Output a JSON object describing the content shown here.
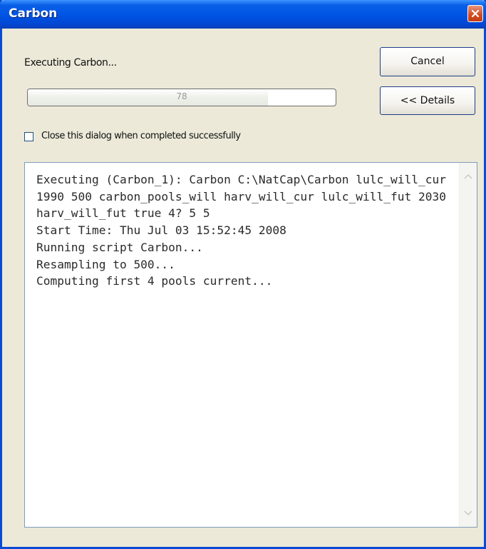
{
  "window": {
    "title": "Carbon"
  },
  "status": {
    "label": "Executing Carbon..."
  },
  "progress": {
    "fraction": 0.78,
    "text": "78"
  },
  "buttons": {
    "cancel_label": "Cancel",
    "details_label": "<< Details"
  },
  "checkbox": {
    "label": "Close this dialog when completed successfully",
    "checked": false
  },
  "log": {
    "lines": [
      "Executing (Carbon_1): Carbon C:\\NatCap\\Carbon lulc_will_cur 1990 500 carbon_pools_will harv_will_cur lulc_will_fut 2030 harv_will_fut true 4? 5 5",
      "Start Time: Thu Jul 03 15:52:45 2008",
      "Running script Carbon...",
      "Resampling to 500...",
      "Computing first 4 pools current..."
    ]
  },
  "colors": {
    "titlebar": "#0055e5",
    "dialog_bg": "#ece9d8",
    "button_border": "#1f3c88"
  },
  "icons": {
    "close": "close-icon",
    "scroll_up": "scroll-up-icon",
    "scroll_down": "scroll-down-icon"
  }
}
